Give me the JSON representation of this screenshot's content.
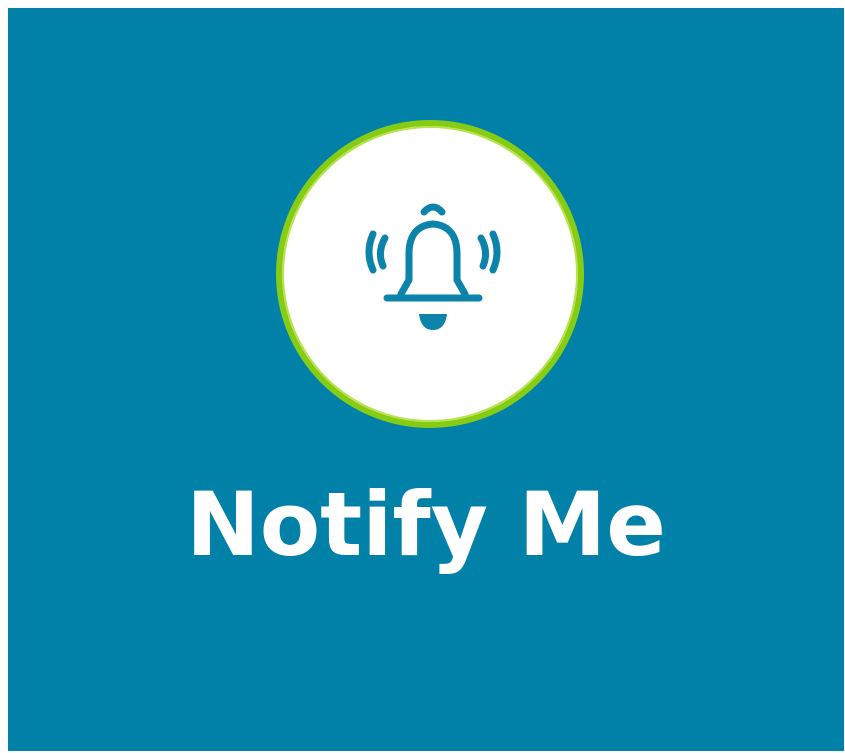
{
  "tile": {
    "label": "Notify Me",
    "icon": "bell-ringing-icon",
    "colors": {
      "background": "#0281a8",
      "ring": "#86cc14",
      "circle": "#ffffff",
      "icon": "#0281a8",
      "text": "#ffffff"
    }
  }
}
